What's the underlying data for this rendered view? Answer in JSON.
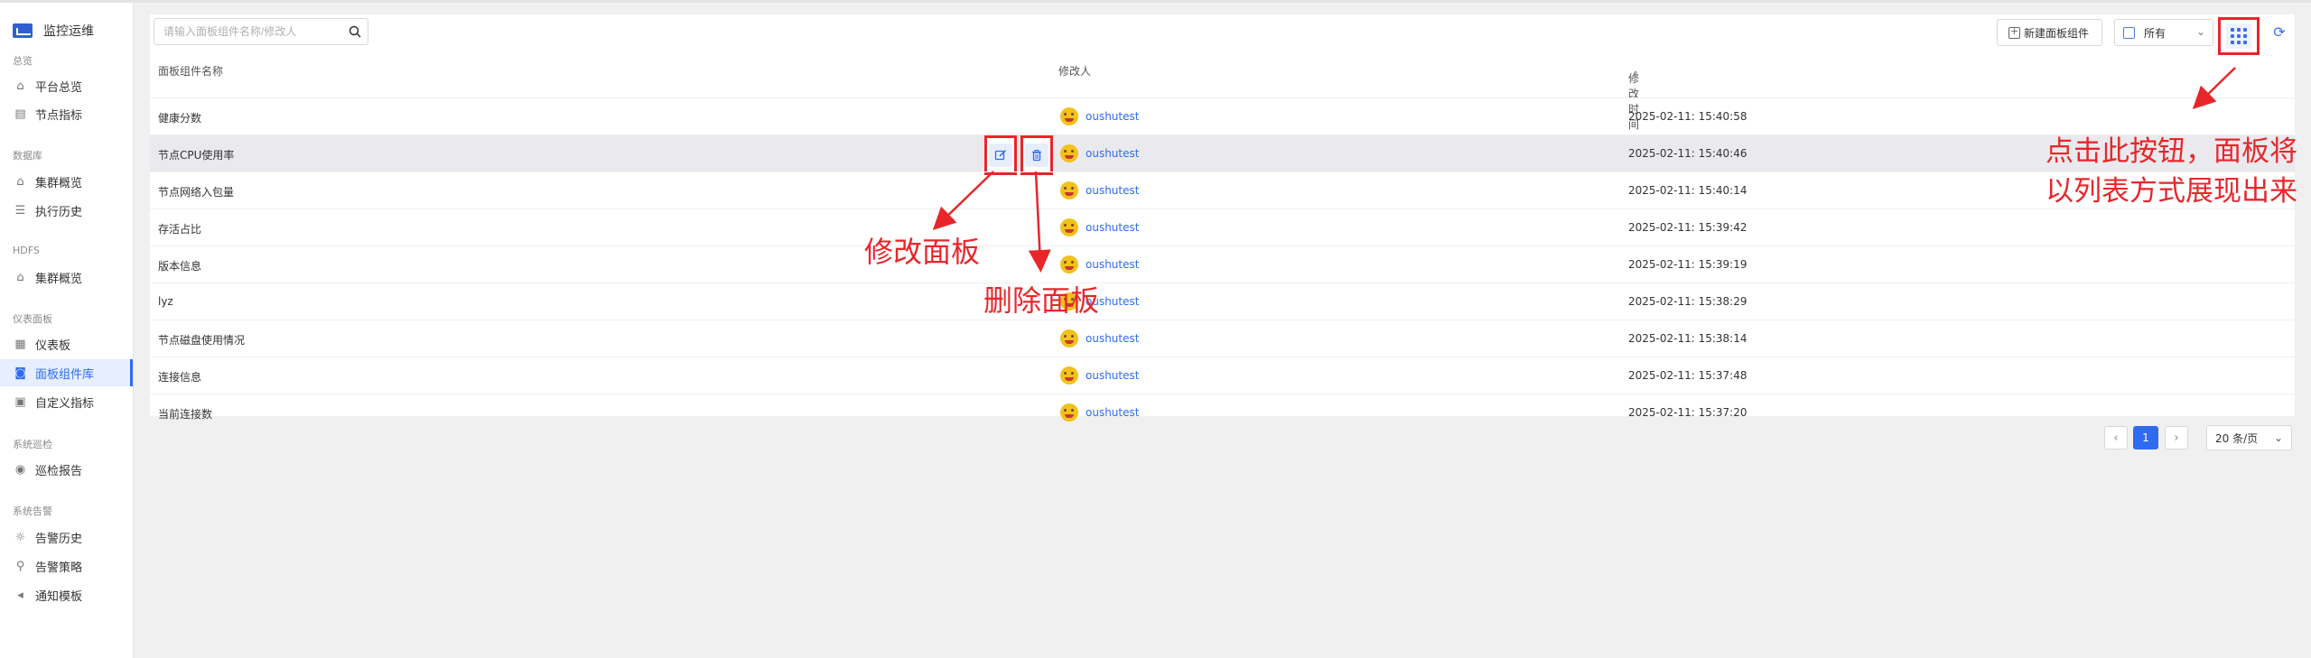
{
  "sidebar": {
    "app_title": "监控运维",
    "groups": [
      {
        "label": "总览",
        "items": [
          {
            "label": "平台总览",
            "icon": "home-icon"
          },
          {
            "label": "节点指标",
            "icon": "chart-icon"
          }
        ]
      },
      {
        "label": "数据库",
        "items": [
          {
            "label": "集群概览",
            "icon": "home-icon"
          },
          {
            "label": "执行历史",
            "icon": "list-icon"
          }
        ]
      },
      {
        "label": "HDFS",
        "items": [
          {
            "label": "集群概览",
            "icon": "home-icon"
          }
        ]
      },
      {
        "label": "仪表面板",
        "items": [
          {
            "label": "仪表板",
            "icon": "dashboard-icon"
          },
          {
            "label": "面板组件库",
            "icon": "component-icon",
            "active": true
          },
          {
            "label": "自定义指标",
            "icon": "custom-icon"
          }
        ]
      },
      {
        "label": "系统巡检",
        "items": [
          {
            "label": "巡检报告",
            "icon": "inspect-icon"
          }
        ]
      },
      {
        "label": "系统告警",
        "items": [
          {
            "label": "告警历史",
            "icon": "alarm-icon"
          },
          {
            "label": "告警策略",
            "icon": "pin-icon"
          },
          {
            "label": "通知模板",
            "icon": "speaker-icon"
          }
        ]
      }
    ]
  },
  "toolbar": {
    "search_placeholder": "请输入面板组件名称/修改人",
    "new_button": "新建面板组件",
    "filter_value": "所有"
  },
  "table": {
    "columns": [
      "面板组件名称",
      "修改人",
      "修改时间"
    ],
    "rows": [
      {
        "name": "健康分数",
        "user": "oushutest",
        "time": "2025-02-11: 15:40:58"
      },
      {
        "name": "节点CPU使用率",
        "user": "oushutest",
        "time": "2025-02-11: 15:40:46"
      },
      {
        "name": "节点网络入包量",
        "user": "oushutest",
        "time": "2025-02-11: 15:40:14"
      },
      {
        "name": "存活占比",
        "user": "oushutest",
        "time": "2025-02-11: 15:39:42"
      },
      {
        "name": "版本信息",
        "user": "oushutest",
        "time": "2025-02-11: 15:39:19"
      },
      {
        "name": "lyz",
        "user": "oushutest",
        "time": "2025-02-11: 15:38:29"
      },
      {
        "name": "节点磁盘使用情况",
        "user": "oushutest",
        "time": "2025-02-11: 15:38:14"
      },
      {
        "name": "连接信息",
        "user": "oushutest",
        "time": "2025-02-11: 15:37:48"
      },
      {
        "name": "当前连接数",
        "user": "oushutest",
        "time": "2025-02-11: 15:37:20"
      }
    ]
  },
  "pagination": {
    "prev": "‹",
    "current": "1",
    "next": "›",
    "page_size": "20 条/页"
  },
  "annotations": {
    "edit": "修改面板",
    "delete": "删除面板",
    "list_view": "点击此按钮，面板将以列表方式展现出来"
  },
  "colors": {
    "accent": "#2f6bf2",
    "annotation_red": "#e8262a",
    "active_bg": "#e6eeff"
  }
}
